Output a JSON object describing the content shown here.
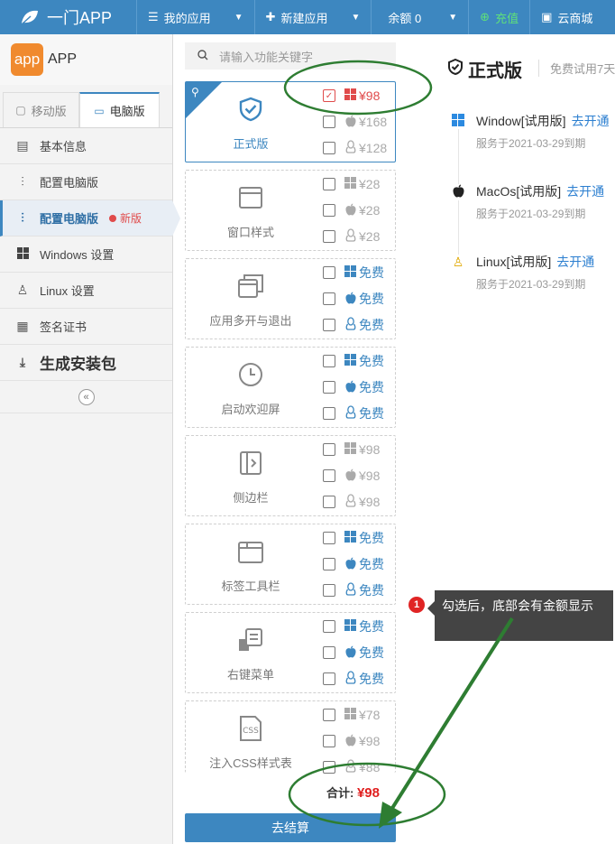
{
  "topbar": {
    "brand": "一门APP",
    "my_apps": "我的应用",
    "new_app": "新建应用",
    "balance": "余额 0",
    "recharge": "充值",
    "cloud": "云商城"
  },
  "sidebar": {
    "app_logo_text": "app",
    "app_name": "APP",
    "tabs": [
      {
        "label": "移动版",
        "icon": "mobile-icon"
      },
      {
        "label": "电脑版",
        "icon": "monitor-icon"
      }
    ],
    "menu": [
      {
        "label": "基本信息",
        "icon": "document-icon"
      },
      {
        "label": "配置电脑版",
        "icon": "sliders-icon"
      },
      {
        "label": "配置电脑版",
        "icon": "sliders-icon",
        "badge": "新版"
      },
      {
        "label": "Windows 设置",
        "icon": "windows-icon"
      },
      {
        "label": "Linux 设置",
        "icon": "linux-icon"
      },
      {
        "label": "签名证书",
        "icon": "certificate-icon"
      },
      {
        "label": "生成安装包",
        "icon": "sort-download-icon"
      }
    ]
  },
  "search": {
    "placeholder": "请输入功能关键字"
  },
  "features": [
    {
      "name": "正式版",
      "icon": "shield-check-icon",
      "options": [
        {
          "os": "windows",
          "price": "¥98"
        },
        {
          "os": "apple",
          "price": "¥168"
        },
        {
          "os": "linux",
          "price": "¥128"
        }
      ]
    },
    {
      "name": "窗口样式",
      "icon": "window-icon",
      "options": [
        {
          "os": "windows",
          "price": "¥28"
        },
        {
          "os": "apple",
          "price": "¥28"
        },
        {
          "os": "linux",
          "price": "¥28"
        }
      ]
    },
    {
      "name": "应用多开与退出",
      "icon": "multi-window-icon",
      "options": [
        {
          "os": "windows",
          "price": "免费"
        },
        {
          "os": "apple",
          "price": "免费"
        },
        {
          "os": "linux",
          "price": "免费"
        }
      ]
    },
    {
      "name": "启动欢迎屏",
      "icon": "clock-icon",
      "options": [
        {
          "os": "windows",
          "price": "免费"
        },
        {
          "os": "apple",
          "price": "免费"
        },
        {
          "os": "linux",
          "price": "免费"
        }
      ]
    },
    {
      "name": "侧边栏",
      "icon": "sidebar-icon",
      "options": [
        {
          "os": "windows",
          "price": "¥98"
        },
        {
          "os": "apple",
          "price": "¥98"
        },
        {
          "os": "linux",
          "price": "¥98"
        }
      ]
    },
    {
      "name": "标签工具栏",
      "icon": "tabs-icon",
      "options": [
        {
          "os": "windows",
          "price": "免费"
        },
        {
          "os": "apple",
          "price": "免费"
        },
        {
          "os": "linux",
          "price": "免费"
        }
      ]
    },
    {
      "name": "右键菜单",
      "icon": "context-menu-icon",
      "options": [
        {
          "os": "windows",
          "price": "免费"
        },
        {
          "os": "apple",
          "price": "免费"
        },
        {
          "os": "linux",
          "price": "免费"
        }
      ]
    },
    {
      "name": "注入CSS样式表",
      "icon": "css-file-icon",
      "options": [
        {
          "os": "windows",
          "price": "¥78"
        },
        {
          "os": "apple",
          "price": "¥98"
        },
        {
          "os": "linux",
          "price": "¥88"
        }
      ]
    }
  ],
  "total": {
    "label": "合计:",
    "amount": "¥98"
  },
  "checkout_label": "去结算",
  "right_panel": {
    "title": "正式版",
    "subtitle": "免费试用7天",
    "platforms": [
      {
        "name": "Window[试用版]",
        "action": "去开通",
        "expiry": "服务于2021-03-29到期"
      },
      {
        "name": "MacOs[试用版]",
        "action": "去开通",
        "expiry": "服务于2021-03-29到期"
      },
      {
        "name": "Linux[试用版]",
        "action": "去开通",
        "expiry": "服务于2021-03-29到期"
      }
    ]
  },
  "tooltip": {
    "number": "1",
    "text": "勾选后，底部会有金额显示"
  },
  "colors": {
    "primary": "#3d87c0",
    "price_red": "#e01f1f",
    "annotation_green": "#2e7d32"
  }
}
